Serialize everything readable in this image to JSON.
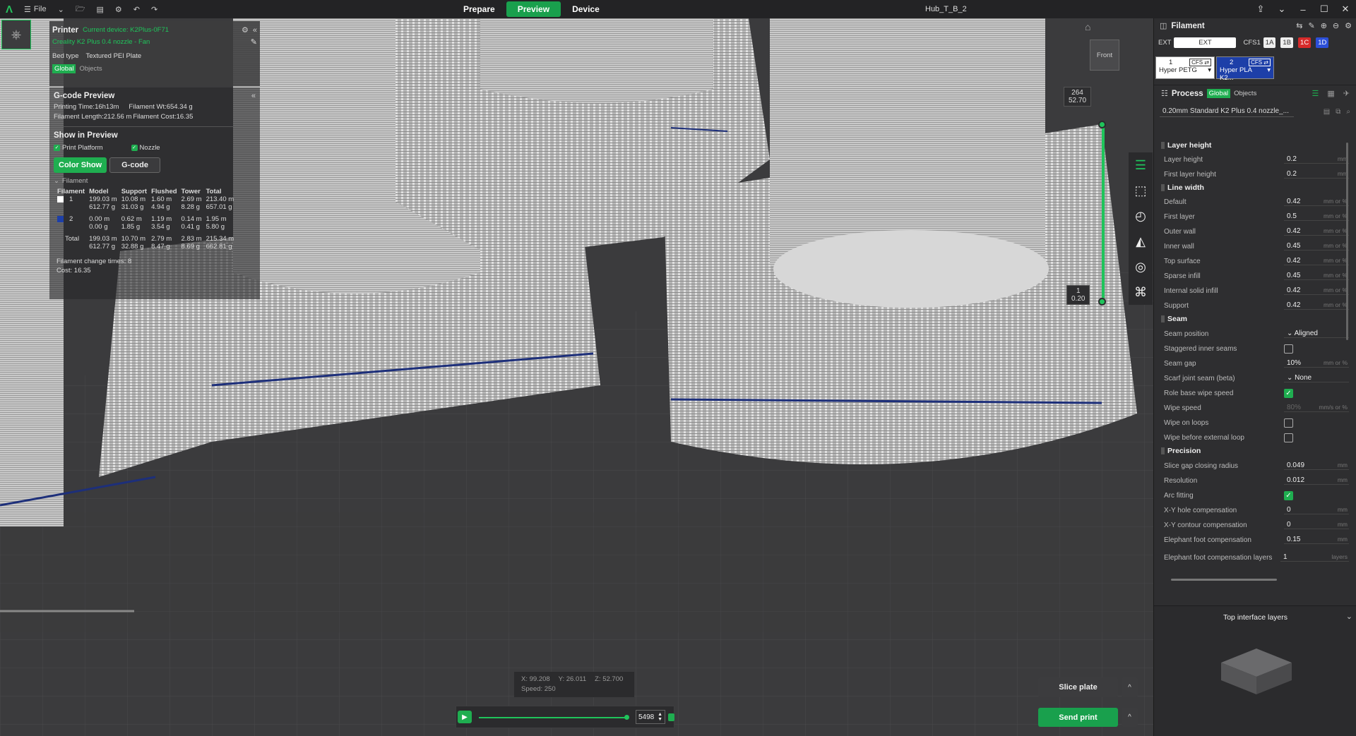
{
  "titlebar": {
    "file_label": "File",
    "tabs": [
      "Prepare",
      "Preview",
      "Device"
    ],
    "active_tab": "Preview",
    "project_title": "Hub_T_B_2"
  },
  "printer": {
    "title": "Printer",
    "current_device": "Current device: K2Plus-0F71",
    "printer_name": "Creality K2 Plus 0.4 nozzle - Fan",
    "bed_type_label": "Bed type",
    "bed_type_value": "Textured PEI Plate",
    "scope_global": "Global",
    "scope_objects": "Objects"
  },
  "gcode_preview": {
    "title": "G-code Preview",
    "printing_time": "Printing Time:16h13m",
    "filament_wt": "Filament Wt:654.34 g",
    "filament_length": "Filament Length:212.56 m",
    "filament_cost": "Filament Cost:16.35",
    "show_in_preview": "Show in Preview",
    "print_platform": "Print Platform",
    "nozzle": "Nozzle",
    "color_show": "Color Show",
    "gcode": "G-code",
    "filament_group": "Filament",
    "headers": [
      "Filament",
      "Model",
      "Support",
      "Flushed",
      "Tower",
      "Total"
    ],
    "rows": [
      {
        "id": "1",
        "swatch": "#ffffff",
        "model": "199.03 m\n612.77 g",
        "support": "10.08 m\n31.03 g",
        "flushed": "1.60 m\n4.94 g",
        "tower": "2.69 m\n8.28 g",
        "total": "213.40 m\n657.01 g"
      },
      {
        "id": "2",
        "swatch": "#1d3fa8",
        "model": "0.00 m\n0.00 g",
        "support": "0.62 m\n1.85 g",
        "flushed": "1.19 m\n3.54 g",
        "tower": "0.14 m\n0.41 g",
        "total": "1.95 m\n5.80 g"
      },
      {
        "id": "Total",
        "swatch": "",
        "model": "199.03 m\n612.77 g",
        "support": "10.70 m\n32.88 g",
        "flushed": "2.79 m\n8.47 g",
        "tower": "2.83 m\n8.69 g",
        "total": "215.34 m\n662.81 g"
      }
    ],
    "change_times": "Filament change times: 8",
    "cost": "Cost: 16.35"
  },
  "layer_slider": {
    "top_layer": "264",
    "top_height": "52.70",
    "bottom_layer": "1",
    "bottom_height": "0.20"
  },
  "view_cube": {
    "label": "Front"
  },
  "filament_panel": {
    "title": "Filament",
    "ext": "EXT",
    "ext_box": "EXT",
    "cfs": "CFS1",
    "slots": [
      "1A",
      "1B",
      "1C",
      "1D"
    ],
    "slot_colors": [
      "#eeeeee",
      "#eeeeee",
      "#d62a2a",
      "#2c4fd8"
    ],
    "filaments": [
      {
        "num": "1",
        "badge": "CFS ⇄",
        "name": "Hyper PETG"
      },
      {
        "num": "2",
        "badge": "CFS ⇄",
        "name": "Hyper PLA K2..."
      }
    ]
  },
  "process": {
    "title": "Process",
    "global": "Global",
    "objects": "Objects",
    "preset": "0.20mm Standard  K2 Plus 0.4 nozzle_..."
  },
  "settings": {
    "layer_height_section": "Layer height",
    "layer_height": {
      "label": "Layer height",
      "value": "0.2",
      "unit": "mm"
    },
    "first_layer_height": {
      "label": "First layer height",
      "value": "0.2",
      "unit": "mm"
    },
    "line_width_section": "Line width",
    "lw_default": {
      "label": "Default",
      "value": "0.42",
      "unit": "mm or %"
    },
    "lw_first": {
      "label": "First layer",
      "value": "0.5",
      "unit": "mm or %"
    },
    "lw_outer": {
      "label": "Outer wall",
      "value": "0.42",
      "unit": "mm or %"
    },
    "lw_inner": {
      "label": "Inner wall",
      "value": "0.45",
      "unit": "mm or %"
    },
    "lw_top": {
      "label": "Top surface",
      "value": "0.42",
      "unit": "mm or %"
    },
    "lw_sparse": {
      "label": "Sparse infill",
      "value": "0.45",
      "unit": "mm or %"
    },
    "lw_internal": {
      "label": "Internal solid infill",
      "value": "0.42",
      "unit": "mm or %"
    },
    "lw_support": {
      "label": "Support",
      "value": "0.42",
      "unit": "mm or %"
    },
    "seam_section": "Seam",
    "seam_position": {
      "label": "Seam position",
      "value": "Aligned"
    },
    "staggered": {
      "label": "Staggered inner seams"
    },
    "seam_gap": {
      "label": "Seam gap",
      "value": "10%",
      "unit": "mm or %"
    },
    "scarf": {
      "label": "Scarf joint seam (beta)",
      "value": "None"
    },
    "role_wipe": {
      "label": "Role base wipe speed"
    },
    "wipe_speed": {
      "label": "Wipe speed",
      "value": "80%",
      "unit": "mm/s or %"
    },
    "wipe_loops": {
      "label": "Wipe on loops"
    },
    "wipe_before": {
      "label": "Wipe before external loop"
    },
    "precision_section": "Precision",
    "slice_gap": {
      "label": "Slice gap closing radius",
      "value": "0.049",
      "unit": "mm"
    },
    "resolution": {
      "label": "Resolution",
      "value": "0.012",
      "unit": "mm"
    },
    "arc_fitting": {
      "label": "Arc fitting"
    },
    "xy_hole": {
      "label": "X-Y hole compensation",
      "value": "0",
      "unit": "mm"
    },
    "xy_contour": {
      "label": "X-Y contour compensation",
      "value": "0",
      "unit": "mm"
    },
    "elephant": {
      "label": "Elephant foot compensation",
      "value": "0.15",
      "unit": "mm"
    },
    "elephant_layers": {
      "label": "Elephant foot compensation layers",
      "value": "1",
      "unit": "layers"
    }
  },
  "preview_panel": {
    "title": "Top interface layers"
  },
  "coords": {
    "x": "X: 99.208",
    "y": "Y: 26.011",
    "z": "Z: 52.700",
    "speed": "Speed: 250"
  },
  "playback": {
    "move_value": "5498"
  },
  "actions": {
    "slice": "Slice plate",
    "send": "Send print"
  }
}
